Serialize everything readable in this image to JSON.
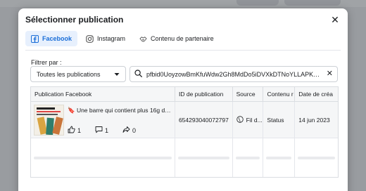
{
  "modal": {
    "title": "Sélectionner publication",
    "close_icon": "close-icon"
  },
  "tabs": [
    {
      "label": "Facebook",
      "icon": "facebook-icon",
      "active": true
    },
    {
      "label": "Instagram",
      "icon": "instagram-icon",
      "active": false
    },
    {
      "label": "Contenu de partenaire",
      "icon": "handshake-icon",
      "active": false
    }
  ],
  "filter": {
    "label": "Filtrer par :",
    "select_value": "Toutes les publications",
    "search_value": "pfbid0UoyzowBmKfuWdw2Gh8MdDo5iDVXkDTNoYLLAPKWHtYB1dhPHc..."
  },
  "table": {
    "headers": [
      "Publication Facebook",
      "ID de publication",
      "Source",
      "Contenu r",
      "Date de créa"
    ],
    "rows": [
      {
        "text": "🔖 Une barre qui contient plus 16g de ...",
        "likes": "1",
        "comments": "1",
        "shares": "0",
        "id": "654293040072797",
        "source": "Fil d...",
        "content": "Status",
        "date": "14 jun 2023"
      }
    ]
  },
  "colors": {
    "accent": "#1a6ed8",
    "tab_active_bg": "#e7f0fd"
  }
}
